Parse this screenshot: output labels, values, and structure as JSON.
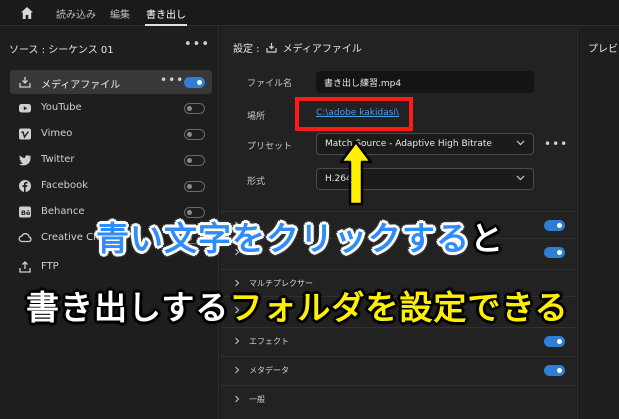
{
  "topbar": {
    "tabs": [
      {
        "label": "読み込み"
      },
      {
        "label": "編集"
      },
      {
        "label": "書き出し",
        "active": true
      }
    ]
  },
  "source_panel": {
    "header": "ソース : シーケンス 01",
    "destinations": [
      {
        "label": "メディアファイル",
        "icon": "media-file-icon",
        "enabled": true,
        "selected": true
      },
      {
        "label": "YouTube",
        "icon": "youtube-icon",
        "enabled": false
      },
      {
        "label": "Vimeo",
        "icon": "vimeo-icon",
        "enabled": false
      },
      {
        "label": "Twitter",
        "icon": "twitter-icon",
        "enabled": false
      },
      {
        "label": "Facebook",
        "icon": "facebook-icon",
        "enabled": false
      },
      {
        "label": "Behance",
        "icon": "behance-icon",
        "enabled": false
      },
      {
        "label": "Creative Cloud",
        "icon": "creative-cloud-icon",
        "enabled": false
      },
      {
        "label": "FTP",
        "icon": "ftp-icon",
        "enabled": false
      }
    ]
  },
  "settings": {
    "header_prefix": "設定 :",
    "header_title": "メディアファイル",
    "filename_label": "ファイル名",
    "filename_value": "書き出し練習.mp4",
    "location_label": "場所",
    "location_value": "C:\\adobe kakidasi\\",
    "preset_label": "プリセット",
    "preset_value": "Match Source - Adaptive High Bitrate",
    "format_label": "形式",
    "format_value": "H.264",
    "sections": [
      {
        "title": "",
        "toggle": true
      },
      {
        "title": "",
        "toggle": true
      },
      {
        "title": "マルチプレクサー",
        "toggle": false
      },
      {
        "title": "",
        "toggle": false
      },
      {
        "title": "エフェクト",
        "toggle": true
      },
      {
        "title": "メタデータ",
        "toggle": true
      },
      {
        "title": "一般",
        "toggle": false
      }
    ]
  },
  "preview_panel": {
    "header": "プレビュー"
  },
  "overlay": {
    "line1_blue": "青い文字をクリックする",
    "line1_white": "と",
    "line2_white": "書き出しする",
    "line2_yellow": "フォルダを設定できる"
  },
  "colors": {
    "accent": "#2d7fd6",
    "highlight_box": "#ff1a1a",
    "caption_blue": "#2f8dfb",
    "caption_yellow": "#ffef00",
    "link": "#4a9cf0"
  }
}
